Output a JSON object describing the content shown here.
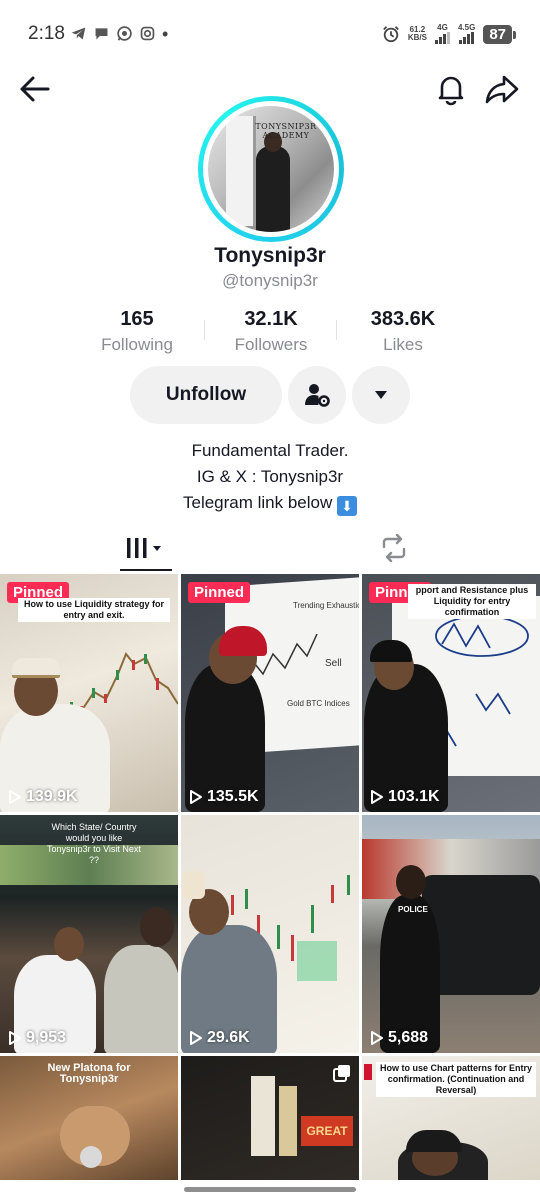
{
  "status_bar": {
    "time": "2:18",
    "net_speed_value": "61.2",
    "net_speed_unit": "KB/S",
    "signal1_label": "4G",
    "signal2_label": "4.5G",
    "battery": "87"
  },
  "profile": {
    "avatar_brand": "TONYSNIP3R ACADEMY",
    "display_name": "Tonysnip3r",
    "handle": "@tonysnip3r",
    "stats": [
      {
        "value": "165",
        "label": "Following"
      },
      {
        "value": "32.1K",
        "label": "Followers"
      },
      {
        "value": "383.6K",
        "label": "Likes"
      }
    ],
    "unfollow_label": "Unfollow",
    "bio_line1": "Fundamental Trader.",
    "bio_line2": "IG & X : Tonysnip3r",
    "bio_line3": "Telegram link below",
    "bio_emoji": "⬇"
  },
  "videos": [
    {
      "pinned": "Pinned",
      "caption": "How to use Liquidity strategy for entry and exit.",
      "views": "139.9K"
    },
    {
      "pinned": "Pinned",
      "caption": "",
      "views": "135.5K"
    },
    {
      "pinned": "Pinned",
      "caption": "pport and Resistance plus Liquidity for entry confirmation",
      "views": "103.1K"
    },
    {
      "pinned": "",
      "caption": "Which State/ Country would you like Tonysnip3r to Visit Next ??",
      "views": "9,953"
    },
    {
      "pinned": "",
      "caption": "",
      "views": "29.6K"
    },
    {
      "pinned": "",
      "caption": "",
      "views": "5,688"
    },
    {
      "pinned": "",
      "caption": "New Platona for Tonysnip3r",
      "views": ""
    },
    {
      "pinned": "",
      "caption": "",
      "views": ""
    },
    {
      "pinned": "",
      "caption": "How to use Chart patterns for Entry confirmation. (Continuation and Reversal)",
      "views": ""
    }
  ],
  "whiteboard_text": {
    "v2_notes": "Trending Exhaustion Consolidation",
    "v2_sell": "Sell",
    "v2_gold": "Gold BTC Indices",
    "v3_police": "POLICE",
    "v8_book": "GREAT"
  },
  "colors": {
    "accent_pinned": "#fe2c55",
    "avatar_ring": "#22d3ee",
    "secondary_text": "#8a8b91"
  }
}
